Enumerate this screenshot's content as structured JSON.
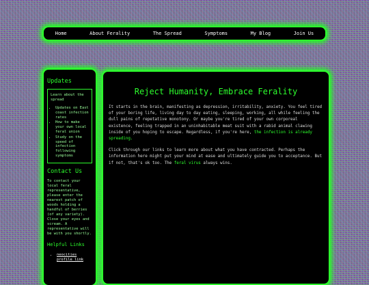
{
  "nav": {
    "items": [
      {
        "label": "Home"
      },
      {
        "label": "About Ferality"
      },
      {
        "label": "The Spread"
      },
      {
        "label": "Symptoms"
      },
      {
        "label": "My Blog"
      },
      {
        "label": "Join Us"
      }
    ]
  },
  "sidebar": {
    "updates_heading": "Updates",
    "updates_intro": "Learn about the spread",
    "updates_items": [
      "Updates on East coast infection rates",
      "How to make your own local feral union",
      "Study on the speed of infection following symptoms"
    ],
    "contact_heading": "Contact Us",
    "contact_text": "To contact your local feral representative, please enter the nearest patch of woods holding a handful of berries (of any variety). Close your eyes and scream. A representative will be with you shortly.",
    "links_heading": "Helpful Links",
    "links": [
      "neocities profile link"
    ]
  },
  "main": {
    "title": "Reject Humanity, Embrace Ferality",
    "p1_text": "It starts in the brain, manifesting as depression, irritability, anxiety. You feel tired of your boring life, living day to day eating, sleeping, working, all while feeling the dull pains of repetative monotony. Or maybe you're tired of your own corporeal existence, feeling trapped in an uninhabitable meat suit with a rabid animal clawing inside of you hoping to escape. Regardless, if you're here,",
    "p1_highlight": "the infection is already spreading.",
    "p2_text": "Click through our links to learn more about what you have contracted. Perhaps the information here might put your mind at ease and ultimately guide you to acceptance. But if not, that's ok too. The",
    "p2_highlight": "feral virus",
    "p2_end": "always wins."
  }
}
